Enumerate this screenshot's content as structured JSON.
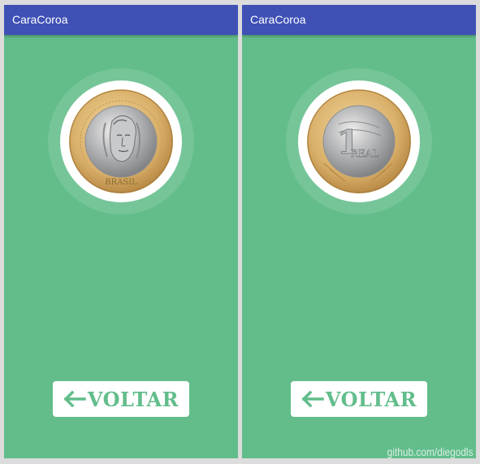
{
  "screens": [
    {
      "app_title": "CaraCoroa",
      "coin_side": "heads",
      "coin_text": "BRASIL",
      "button_label": "VOLTAR"
    },
    {
      "app_title": "CaraCoroa",
      "coin_side": "tails",
      "coin_value": "1",
      "coin_text": "REAL",
      "button_label": "VOLTAR"
    }
  ],
  "watermark": "github.com/diegodls",
  "icons": {
    "back": "arrow-left-icon",
    "heads": "coin-heads-icon",
    "tails": "coin-tails-icon"
  },
  "colors": {
    "background": "#62bd8b",
    "appbar": "#3f51b5",
    "button": "#ffffff",
    "button_text": "#62bd8b"
  }
}
